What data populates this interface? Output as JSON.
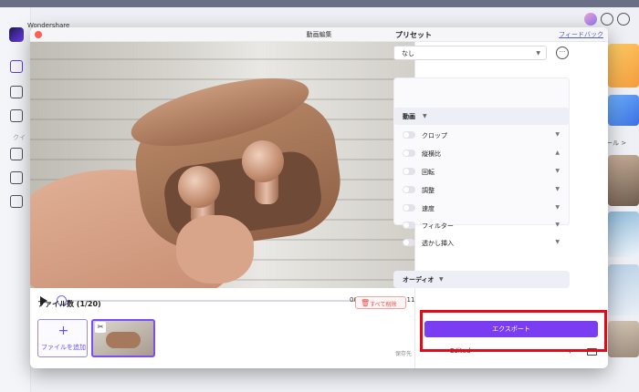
{
  "app": {
    "name": "Wondershare",
    "side_text": "クイ",
    "right_link": "ール >"
  },
  "dialog": {
    "title": "動画編集",
    "feedback": "フィードバック"
  },
  "player": {
    "current_time": "00:00:00",
    "separator": "/",
    "total_time": "00:00:11",
    "progress": 0
  },
  "files": {
    "label": "ファイル数 (1/20)",
    "delete_all": "すべて削除",
    "add_plus": "+",
    "add_label": "ファイルを追加"
  },
  "preset": {
    "title": "プリセット",
    "value": "なし"
  },
  "video_section": {
    "title": "動画",
    "options": [
      {
        "label": "クロップ",
        "chevron": "▼"
      },
      {
        "label": "縦横比",
        "chevron": "▲"
      },
      {
        "label": "回転",
        "chevron": "▼"
      },
      {
        "label": "調整",
        "chevron": "▼"
      },
      {
        "label": "速度",
        "chevron": "▼"
      },
      {
        "label": "フィルター",
        "chevron": "▼"
      },
      {
        "label": "透かし挿入",
        "chevron": "▼"
      }
    ]
  },
  "audio_section": {
    "title": "オーディオ"
  },
  "export": {
    "label": "エクスポート",
    "save_label": "保存先",
    "save_value": "Edited"
  },
  "colors": {
    "accent": "#7a3df2",
    "highlight": "#e40b18"
  }
}
